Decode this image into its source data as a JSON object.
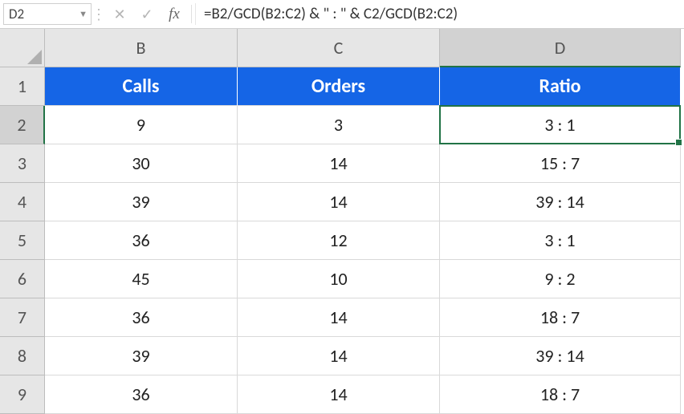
{
  "name_box": {
    "value": "D2"
  },
  "formula_bar": {
    "fx_label": "fx",
    "formula": "=B2/GCD(B2:C2) & \" : \" & C2/GCD(B2:C2)"
  },
  "columns": [
    "B",
    "C",
    "D"
  ],
  "selected_column_index": 2,
  "selected_row_index": 1,
  "headers": {
    "B": "Calls",
    "C": "Orders",
    "D": "Ratio"
  },
  "rows": [
    {
      "n": "1"
    },
    {
      "n": "2",
      "B": "9",
      "C": "3",
      "D": "3 : 1"
    },
    {
      "n": "3",
      "B": "30",
      "C": "14",
      "D": "15 : 7"
    },
    {
      "n": "4",
      "B": "39",
      "C": "14",
      "D": "39 : 14"
    },
    {
      "n": "5",
      "B": "36",
      "C": "12",
      "D": "3 : 1"
    },
    {
      "n": "6",
      "B": "45",
      "C": "10",
      "D": "9 : 2"
    },
    {
      "n": "7",
      "B": "36",
      "C": "14",
      "D": "18 : 7"
    },
    {
      "n": "8",
      "B": "39",
      "C": "14",
      "D": "39 : 14"
    },
    {
      "n": "9",
      "B": "36",
      "C": "14",
      "D": "18 : 7"
    }
  ]
}
